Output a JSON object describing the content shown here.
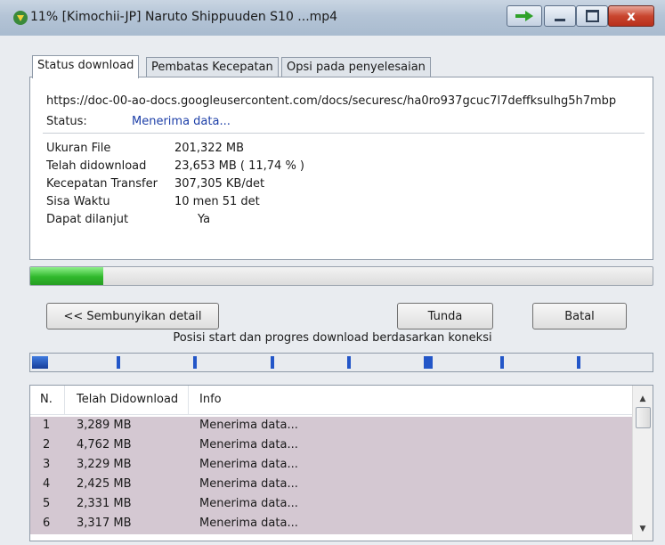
{
  "window": {
    "title": "11% [Kimochii-JP] Naruto Shippuuden S10 ...mp4",
    "close_symbol": "x"
  },
  "tabs": [
    {
      "label": "Status download"
    },
    {
      "label": "Pembatas Kecepatan"
    },
    {
      "label": "Opsi pada penyelesaian"
    }
  ],
  "status": {
    "url": "https://doc-00-ao-docs.googleusercontent.com/docs/securesc/ha0ro937gcuc7l7deffksulhg5h7mbp",
    "label": "Status:",
    "value": "Menerima data...",
    "details": [
      {
        "label": "Ukuran File",
        "value": "201,322  MB"
      },
      {
        "label": "Telah didownload",
        "value": "23,653  MB  ( 11,74 % )"
      },
      {
        "label": "Kecepatan Transfer",
        "value": "307,305  KB/det"
      },
      {
        "label": "Sisa Waktu",
        "value": "10 men 51 det"
      },
      {
        "label": "Dapat dilanjut",
        "value": "Ya"
      }
    ]
  },
  "progress": {
    "fraction": 0.1174
  },
  "buttons": {
    "hide_details": "<< Sembunyikan detail",
    "pause": "Tunda",
    "cancel": "Batal"
  },
  "connections": {
    "caption": "Posisi start dan progres download berdasarkan koneksi"
  },
  "table": {
    "headers": [
      "N.",
      "Telah Didownload",
      "Info"
    ],
    "rows": [
      {
        "n": "1",
        "downloaded": "3,289  MB",
        "info": "Menerima data..."
      },
      {
        "n": "2",
        "downloaded": "4,762  MB",
        "info": "Menerima data..."
      },
      {
        "n": "3",
        "downloaded": "3,229  MB",
        "info": "Menerima data..."
      },
      {
        "n": "4",
        "downloaded": "2,425  MB",
        "info": "Menerima data..."
      },
      {
        "n": "5",
        "downloaded": "2,331  MB",
        "info": "Menerima data..."
      },
      {
        "n": "6",
        "downloaded": "3,317  MB",
        "info": "Menerima data..."
      }
    ]
  },
  "colors": {
    "progress_fill": "#30b82c",
    "connection_marker": "#2356c8",
    "row_highlight": "#d4c8d2",
    "status_value": "#1d3fa8"
  },
  "icons": {
    "app": "download-arrow-icon",
    "window_extra": "green-arrow-icon",
    "minimize": "minimize-icon",
    "maximize": "maximize-icon",
    "close": "close-icon",
    "scroll_up": "scroll-up-icon",
    "scroll_down": "scroll-down-icon"
  }
}
